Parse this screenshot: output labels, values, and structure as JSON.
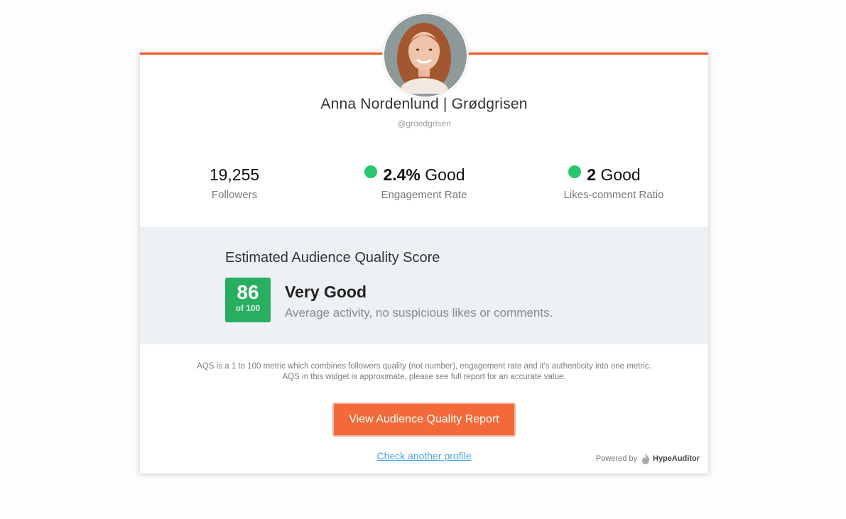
{
  "profile": {
    "name": "Anna Nordenlund | Grødgrisen",
    "handle": "@groedgrisen"
  },
  "stats": {
    "followers": {
      "value": "19,255",
      "label": "Followers"
    },
    "engagement": {
      "value": "2.4%",
      "rating": "Good",
      "label": "Engagement Rate",
      "status_color": "#28c76f"
    },
    "likes_comment": {
      "value": "2",
      "rating": "Good",
      "label": "Likes-comment Ratio",
      "status_color": "#28c76f"
    }
  },
  "aqs": {
    "heading": "Estimated Audience Quality Score",
    "score": "86",
    "of": "of 100",
    "verdict": "Very Good",
    "description": "Average activity, no suspicious likes or comments.",
    "score_color": "#27ae60"
  },
  "note": {
    "line1": "AQS is a 1 to 100 metric which combines followers quality (not number), engagement rate and it's authenticity into one metric.",
    "line2": "AQS in this widget is approximate, please see full report for an accurate value."
  },
  "actions": {
    "report_button": "View Audience Quality Report",
    "check_link": "Check another profile"
  },
  "footer": {
    "powered_by": "Powered by",
    "brand": "HypeAuditor",
    "brand_icon": "flame-icon"
  },
  "colors": {
    "accent": "#f05a28",
    "button": "#f36a3a",
    "link": "#4aa3df"
  }
}
